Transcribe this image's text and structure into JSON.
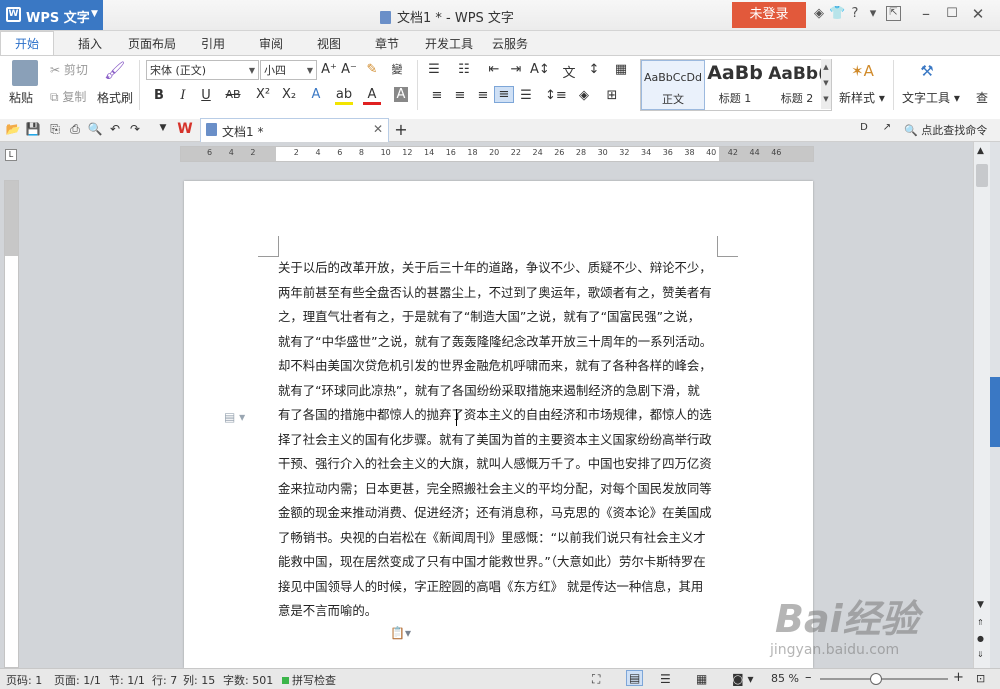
{
  "titlebar": {
    "app_name": "WPS 文字",
    "doc_title": "文档1 * - WPS 文字",
    "login": "未登录"
  },
  "tabs": [
    "开始",
    "插入",
    "页面布局",
    "引用",
    "审阅",
    "视图",
    "章节",
    "开发工具",
    "云服务"
  ],
  "ribbon": {
    "paste": "粘贴",
    "cut": "剪切",
    "copy": "复制",
    "format_painter": "格式刷",
    "font_name": "宋体 (正文)",
    "font_size": "小四",
    "styles": [
      {
        "preview": "AaBbCcDd",
        "label": "正文"
      },
      {
        "preview": "AaBb",
        "label": "标题 1"
      },
      {
        "preview": "AaBb(",
        "label": "标题 2"
      }
    ],
    "new_style": "新样式",
    "text_tools": "文字工具"
  },
  "doc_tab": {
    "label": "文档1 *",
    "search": "点此查找命令"
  },
  "ruler_ticks": [
    "6",
    "4",
    "2",
    "",
    "2",
    "4",
    "6",
    "8",
    "10",
    "12",
    "14",
    "16",
    "18",
    "20",
    "22",
    "24",
    "26",
    "28",
    "30",
    "32",
    "34",
    "36",
    "38",
    "40",
    "42",
    "44",
    "46"
  ],
  "document": {
    "lines": [
      "关于以后的改革开放，关于后三十年的道路，争议不少、质疑不少、辩论不少，",
      "两年前甚至有些全盘否认的甚嚣尘上，不过到了奥运年，歌颂者有之，赞美者有",
      "之，理直气壮者有之，于是就有了“制造大国”之说，就有了“国富民强”之说，",
      "就有了“中华盛世”之说，就有了轰轰隆隆纪念改革开放三十周年的一系列活动。",
      "却不料由美国次贷危机引发的世界金融危机呼啸而来，就有了各种各样的峰会，",
      "就有了“环球同此凉热”，就有了各国纷纷采取措施来遏制经济的急剧下滑，就",
      "有了各国的措施中都惊人的抛弃了资本主义的自由经济和市场规律，都惊人的选",
      "择了社会主义的国有化步骤。就有了美国为首的主要资本主义国家纷纷高举行政",
      "干预、强行介入的社会主义的大旗，就叫人感慨万千了。中国也安排了四万亿资",
      "金来拉动内需；日本更甚，完全照搬社会主义的平均分配，对每个国民发放同等",
      "金额的现金来推动消费、促进经济；还有消息称，马克思的《资本论》在美国成",
      "了畅销书。央视的白岩松在《新闻周刊》里感慨：“以前我们说只有社会主义才",
      "能救中国，现在居然变成了只有中国才能救世界。”（大意如此）劳尔卡斯特罗在",
      "接见中国领导人的时候，字正腔圆的高唱《东方红》 就是传达一种信息，其用",
      "意是不言而喻的。"
    ]
  },
  "status": {
    "page_num": "页码: 1",
    "pages": "页面: 1/1",
    "section": "节: 1/1",
    "row": "行: 7",
    "col": "列: 15",
    "word_count": "字数: 501",
    "spell_check": "拼写检查",
    "zoom": "85 %"
  },
  "watermark": {
    "brand": "Bai经验",
    "url": "jingyan.baidu.com"
  },
  "colors": {
    "accent": "#3a78c4",
    "login": "#e2593b",
    "tab_active": "#2a6fc9"
  }
}
